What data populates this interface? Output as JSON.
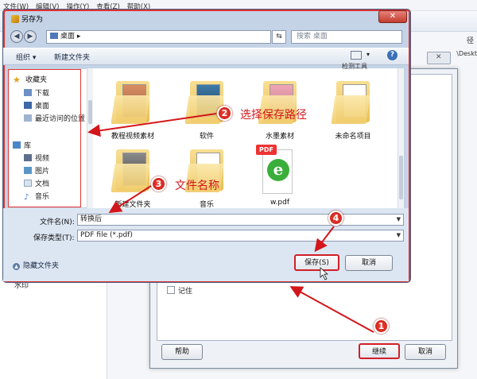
{
  "bg_app": {
    "menu": [
      "文件(W)",
      "编辑(V)",
      "操作(Y)",
      "查看(Z)",
      "帮助(X)"
    ],
    "right_text_1": "径",
    "right_text_2": "\\Deskt",
    "left_item": "水印"
  },
  "save_dialog": {
    "title": "另存为",
    "close": "✕",
    "address": "桌面",
    "search_placeholder": "搜索 桌面",
    "toolbar": {
      "organize": "组织 ▾",
      "new_folder": "新建文件夹"
    },
    "nav": {
      "favorites": "收藏夹",
      "downloads": "下载",
      "desktop": "桌面",
      "recent": "最近访问的位置",
      "libraries": "库",
      "videos": "视频",
      "pictures": "图片",
      "documents": "文档",
      "music": "音乐"
    },
    "top_partial_label": "检测工具",
    "files": [
      {
        "name": "教程视频素材"
      },
      {
        "name": "软件"
      },
      {
        "name": "水墨素材"
      },
      {
        "name": "未命名项目"
      },
      {
        "name": "新建文件夹"
      },
      {
        "name": "音乐"
      },
      {
        "name": "w.pdf",
        "tag": "PDF"
      }
    ],
    "filename_label": "文件名(N):",
    "filename_value": "转换后",
    "filetype_label": "保存类型(T):",
    "filetype_value": "PDF file (*.pdf)",
    "hide_folders": "隐藏文件夹",
    "save_button": "保存(S)",
    "cancel_button": "取消"
  },
  "continue_dialog": {
    "remember": "记住",
    "help_button": "帮助",
    "continue_button": "继续",
    "cancel_button": "取消"
  },
  "annotations": {
    "step1": "1",
    "step2": "2",
    "step2_text": "选择保存路径",
    "step3": "3",
    "step3_text": "文件名称",
    "step4": "4"
  },
  "colors": {
    "annotation_red": "#d3161a",
    "dialog_frame": "#c4d3e6"
  }
}
